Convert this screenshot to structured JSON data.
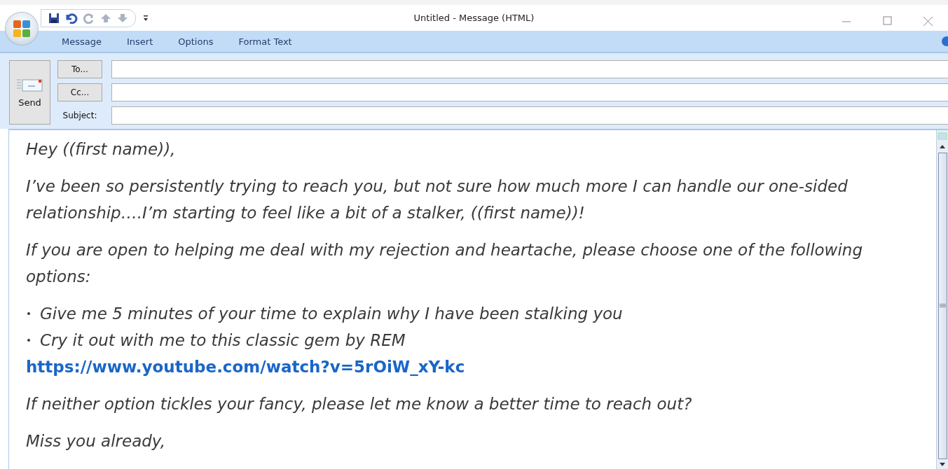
{
  "window": {
    "title": "Untitled - Message (HTML)"
  },
  "tabs": [
    {
      "label": "Message"
    },
    {
      "label": "Insert"
    },
    {
      "label": "Options"
    },
    {
      "label": "Format Text"
    }
  ],
  "send": {
    "label": "Send"
  },
  "fields": [
    {
      "kind": "button",
      "label": "To..."
    },
    {
      "kind": "button",
      "label": "Cc..."
    },
    {
      "kind": "label",
      "label": "Subject:"
    }
  ],
  "body": [
    {
      "kind": "paragraph",
      "text": "Hey ((first name)),"
    },
    {
      "kind": "paragraph",
      "text": "I’ve been so persistently trying to reach you, but not sure how much more I can handle our one-sided relationship….I’m starting to feel like a bit of a stalker, ((first name))!"
    },
    {
      "kind": "paragraph",
      "text": "If you are open to helping me deal with my rejection and heartache, please choose one of the following options:"
    },
    {
      "kind": "bullets",
      "items": [
        "Give me 5 minutes of your time to explain why I have been stalking you",
        "Cry it out with me to this classic gem by REM"
      ]
    },
    {
      "kind": "link",
      "text": "https://www.youtube.com/watch?v=5rOiW_xY-kc"
    },
    {
      "kind": "paragraph",
      "text": "If neither option tickles your fancy, please let me know a better time to reach out?"
    },
    {
      "kind": "paragraph",
      "text": "Miss you already,"
    }
  ]
}
